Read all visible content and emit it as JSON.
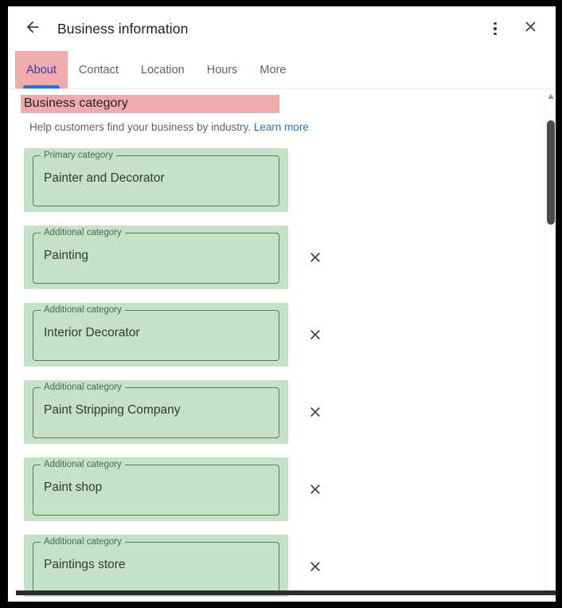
{
  "window": {
    "title": "Business information"
  },
  "header": {
    "back_icon": "arrow-left-icon",
    "title": "Business information",
    "kebab_icon": "more-vert-icon",
    "close_icon": "close-icon"
  },
  "tabs": [
    {
      "label": "About",
      "active": true
    },
    {
      "label": "Contact",
      "active": false
    },
    {
      "label": "Location",
      "active": false
    },
    {
      "label": "Hours",
      "active": false
    },
    {
      "label": "More",
      "active": false
    }
  ],
  "section": {
    "heading": "Business category",
    "helper_text": "Help customers find your business by industry.",
    "learn_more_label": "Learn more"
  },
  "categories": [
    {
      "legend": "Primary category",
      "value": "Painter and Decorator",
      "removable": false
    },
    {
      "legend": "Additional category",
      "value": "Painting",
      "removable": true
    },
    {
      "legend": "Additional category",
      "value": "Interior Decorator",
      "removable": true
    },
    {
      "legend": "Additional category",
      "value": "Paint Stripping Company",
      "removable": true
    },
    {
      "legend": "Additional category",
      "value": "Paint shop",
      "removable": true
    },
    {
      "legend": "Additional category",
      "value": "Paintings store",
      "removable": true
    }
  ],
  "remove_icon": "close-icon",
  "colors": {
    "highlight_pink": "#efabab",
    "highlight_green": "#c6e2c6",
    "link_blue": "#1a73e8",
    "active_tab_text": "#3b3fa8",
    "tab_underline": "#1a73e8",
    "field_border": "#5d7a5d"
  },
  "scrollbar": {
    "orientation": "vertical",
    "thumb_position": "near-top"
  }
}
